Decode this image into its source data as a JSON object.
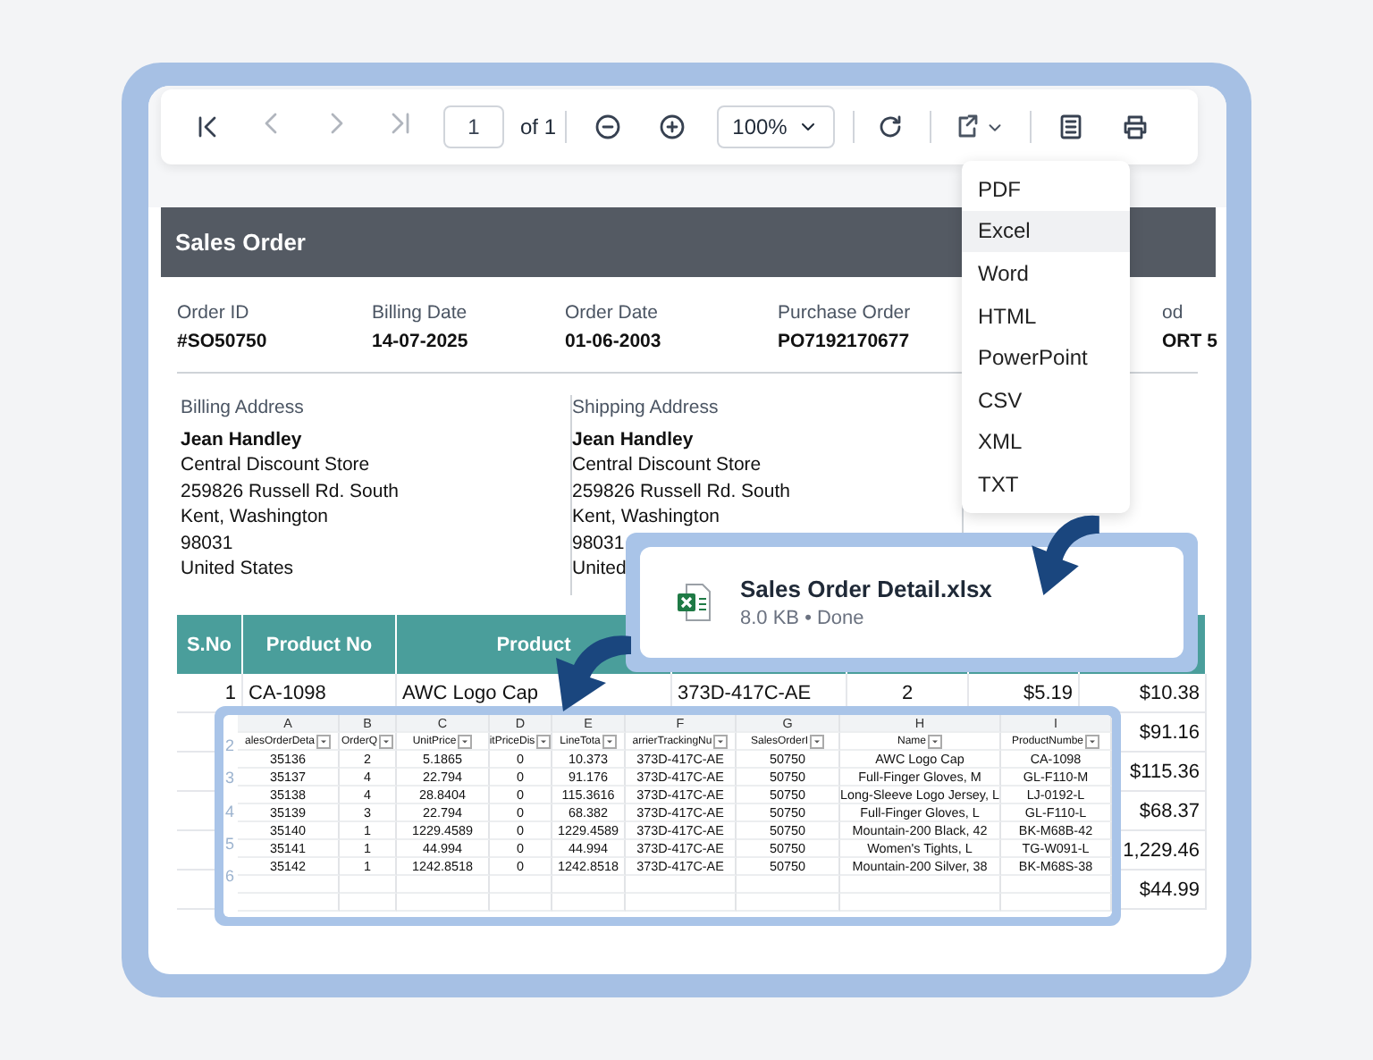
{
  "toolbar": {
    "page": "1",
    "page_count": "of 1",
    "zoom": "100%"
  },
  "export_menu": {
    "items": [
      {
        "label": "PDF",
        "selected": false
      },
      {
        "label": "Excel",
        "selected": true
      },
      {
        "label": "Word",
        "selected": false
      },
      {
        "label": "HTML",
        "selected": false
      },
      {
        "label": "PowerPoint",
        "selected": false
      },
      {
        "label": "CSV",
        "selected": false
      },
      {
        "label": "XML",
        "selected": false
      },
      {
        "label": "TXT",
        "selected": false
      }
    ]
  },
  "report": {
    "title": "Sales Order",
    "info": [
      {
        "label": "Order ID",
        "value": "#SO50750"
      },
      {
        "label": "Billing Date",
        "value": "14-07-2025"
      },
      {
        "label": "Order Date",
        "value": "01-06-2003"
      },
      {
        "label": "Purchase Order",
        "value": "PO7192170677"
      },
      {
        "label": "od",
        "value": "ORT 5"
      }
    ],
    "addresses": [
      {
        "label": "Billing Address",
        "name": "Jean Handley",
        "lines": [
          "Central Discount Store",
          "259826 Russell Rd. South",
          "Kent, Washington",
          "98031",
          "United States"
        ]
      },
      {
        "label": "Shipping Address",
        "name": "Jean Handley",
        "lines": [
          "Central Discount Store",
          "259826 Russell Rd. South",
          "Kent, Washington",
          "98031",
          "United"
        ]
      }
    ],
    "table": {
      "columns": [
        "S.No",
        "Product No",
        "Product"
      ],
      "rows": [
        {
          "cells": [
            "1",
            "CA-1098",
            "AWC Logo Cap",
            "373D-417C-AE",
            "2",
            "$5.19",
            "$10.38"
          ]
        },
        {
          "cells": [
            null,
            null,
            null,
            null,
            null,
            null,
            "$91.16"
          ]
        },
        {
          "cells": [
            null,
            null,
            null,
            null,
            null,
            null,
            "$115.36"
          ]
        },
        {
          "cells": [
            null,
            null,
            null,
            null,
            null,
            null,
            "$68.37"
          ]
        },
        {
          "cells": [
            null,
            null,
            null,
            null,
            null,
            null,
            "1,229.46"
          ]
        },
        {
          "cells": [
            null,
            null,
            null,
            null,
            null,
            null,
            "$44.99"
          ]
        }
      ]
    }
  },
  "download": {
    "file_name": "Sales Order Detail.xlsx",
    "status": "8.0 KB • Done"
  },
  "spreadsheet": {
    "column_letters": [
      "A",
      "B",
      "C",
      "D",
      "E",
      "F",
      "G",
      "H",
      "I"
    ],
    "row_numbers": [
      "2",
      "3",
      "4",
      "5",
      "6"
    ],
    "headers": [
      "alesOrderDeta",
      "OrderQ",
      "UnitPrice",
      "itPriceDis",
      "LineTota",
      "arrierTrackingNu",
      "SalesOrderI",
      "Name",
      "ProductNumbe"
    ],
    "rows": [
      [
        "35136",
        "2",
        "5.1865",
        "0",
        "10.373",
        "373D-417C-AE",
        "50750",
        "AWC Logo Cap",
        "CA-1098"
      ],
      [
        "35137",
        "4",
        "22.794",
        "0",
        "91.176",
        "373D-417C-AE",
        "50750",
        "Full-Finger Gloves, M",
        "GL-F110-M"
      ],
      [
        "35138",
        "4",
        "28.8404",
        "0",
        "115.3616",
        "373D-417C-AE",
        "50750",
        "Long-Sleeve Logo Jersey, L",
        "LJ-0192-L"
      ],
      [
        "35139",
        "3",
        "22.794",
        "0",
        "68.382",
        "373D-417C-AE",
        "50750",
        "Full-Finger Gloves, L",
        "GL-F110-L"
      ],
      [
        "35140",
        "1",
        "1229.4589",
        "0",
        "1229.4589",
        "373D-417C-AE",
        "50750",
        "Mountain-200 Black, 42",
        "BK-M68B-42"
      ],
      [
        "35141",
        "1",
        "44.994",
        "0",
        "44.994",
        "373D-417C-AE",
        "50750",
        "Women's Tights, L",
        "TG-W091-L"
      ],
      [
        "35142",
        "1",
        "1242.8518",
        "0",
        "1242.8518",
        "373D-417C-AE",
        "50750",
        "Mountain-200 Silver, 38",
        "BK-M68S-38"
      ]
    ]
  }
}
